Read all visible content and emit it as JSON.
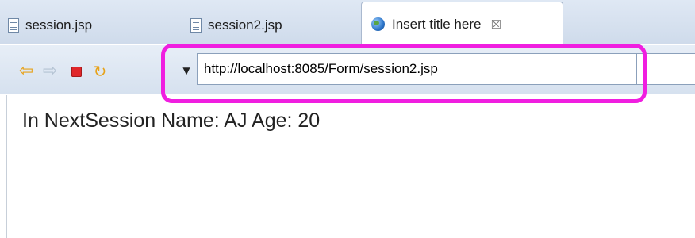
{
  "tabs": [
    {
      "label": "session.jsp",
      "icon": "jsp-file-icon",
      "active": false
    },
    {
      "label": "session2.jsp",
      "icon": "jsp-file-icon",
      "active": false
    },
    {
      "label": "Insert title here",
      "icon": "globe-icon",
      "active": true,
      "close_glyph": "☒"
    }
  ],
  "toolbar": {
    "back_glyph": "⇦",
    "forward_glyph": "⇨",
    "refresh_glyph": "↻",
    "dropdown_glyph": "▼"
  },
  "address_bar": {
    "url": "http://localhost:8085/Form/session2.jsp"
  },
  "page": {
    "text": "In NextSession Name: AJ Age: 20"
  },
  "colors": {
    "highlight": "#f01ee0",
    "stop": "#e0262a",
    "nav_arrow": "#e7a21a"
  }
}
